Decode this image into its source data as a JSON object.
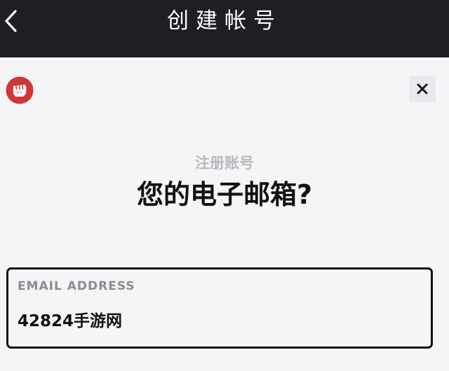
{
  "header": {
    "title": "创建帐号",
    "back_icon": "chevron-left-icon",
    "background_color": "#1e1f23"
  },
  "brand": {
    "logo_icon": "riot-fist-logo",
    "accent_color": "#d13639"
  },
  "dialog": {
    "close_icon": "close-icon",
    "subtitle": "注册账号",
    "headline": "您的电子邮箱?"
  },
  "email_field": {
    "label": "EMAIL ADDRESS",
    "value": "42824手游网",
    "border_color": "#111111"
  }
}
